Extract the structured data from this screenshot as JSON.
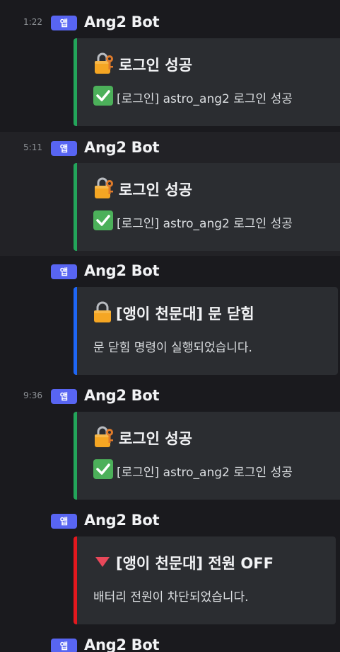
{
  "messages": [
    {
      "time": "1:22",
      "badge": "앱",
      "author": "Ang2 Bot",
      "embed": {
        "accent": "#23a55a",
        "title_icon": "lock-with-key-icon",
        "title": "로그인 성공",
        "desc_icon": "check-mark-icon",
        "description": "[로그인] astro_ang2 로그인 성공"
      }
    },
    {
      "time": "5:11",
      "badge": "앱",
      "author": "Ang2 Bot",
      "embed": {
        "accent": "#23a55a",
        "title_icon": "lock-with-key-icon",
        "title": "로그인 성공",
        "desc_icon": "check-mark-icon",
        "description": "[로그인] astro_ang2 로그인 성공"
      }
    },
    {
      "time": "",
      "badge": "앱",
      "author": "Ang2 Bot",
      "embed": {
        "accent": "#1e66f5",
        "title_icon": "lock-icon",
        "title": "[앵이 천문대] 문 닫힘",
        "description": "문 닫힘 명령이 실행되었습니다."
      }
    },
    {
      "time": "9:36",
      "badge": "앱",
      "author": "Ang2 Bot",
      "embed": {
        "accent": "#23a55a",
        "title_icon": "lock-with-key-icon",
        "title": "로그인 성공",
        "desc_icon": "check-mark-icon",
        "description": "[로그인] astro_ang2 로그인 성공"
      }
    },
    {
      "time": "",
      "badge": "앱",
      "author": "Ang2 Bot",
      "embed": {
        "accent": "#e3181e",
        "title_icon": "red-down-triangle-icon",
        "title": "[앵이 천문대] 전원 OFF",
        "description": "배터리 전원이 차단되었습니다."
      }
    },
    {
      "time": "",
      "badge": "앱",
      "author": "Ang2 Bot"
    }
  ]
}
